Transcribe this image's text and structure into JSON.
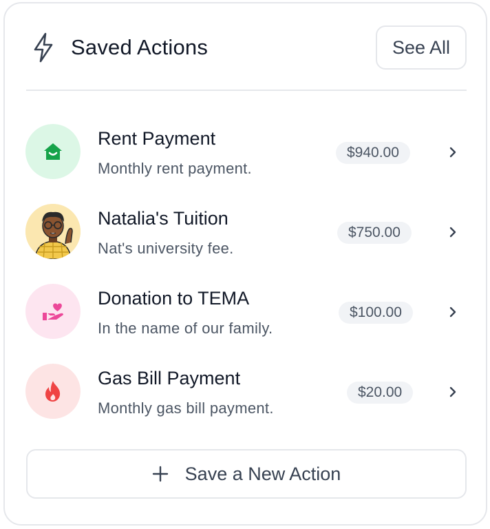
{
  "header": {
    "icon": "lightning-bolt-icon",
    "title": "Saved Actions",
    "see_all_label": "See All"
  },
  "actions": [
    {
      "name": "Rent Payment",
      "description": "Monthly rent payment.",
      "amount": "$940.00",
      "icon": "home-icon",
      "accent": "#16a34a"
    },
    {
      "name": "Natalia's Tuition",
      "description": "Nat's university fee.",
      "amount": "$750.00",
      "icon": "person-avatar",
      "accent": "#f59e0b"
    },
    {
      "name": "Donation to TEMA",
      "description": "In the name of our family.",
      "amount": "$100.00",
      "icon": "heart-hand-icon",
      "accent": "#ec4899"
    },
    {
      "name": "Gas Bill Payment",
      "description": "Monthly gas bill payment.",
      "amount": "$20.00",
      "icon": "flame-icon",
      "accent": "#ef4444"
    }
  ],
  "footer": {
    "add_label": "Save a New Action",
    "add_icon": "plus-icon"
  }
}
